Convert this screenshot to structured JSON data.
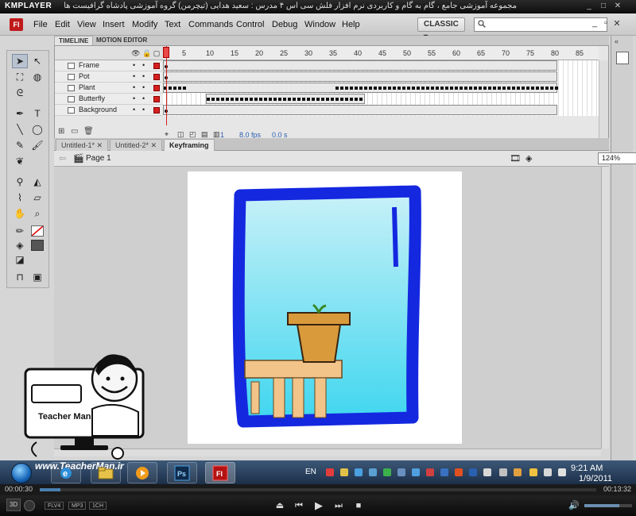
{
  "km_title": {
    "logo": "KMPLAYER",
    "caption": "مجموعه آموزشی جامع ، گام به گام و کاربردی نرم افزار فلش سی اس ۴ مدرس : سعید هدایی (تیچرمن) گروه آموزشی پادشاه گرافیست ها"
  },
  "menubar": {
    "app_logo": "Fl",
    "items": [
      "File",
      "Edit",
      "View",
      "Insert",
      "Modify",
      "Text",
      "Commands",
      "Control",
      "Debug",
      "Window",
      "Help"
    ],
    "workspace": "CLASSIC"
  },
  "timeline": {
    "tabs": [
      "TIMELINE",
      "MOTION EDITOR"
    ],
    "ruler": [
      "1",
      "5",
      "10",
      "15",
      "20",
      "25",
      "30",
      "35",
      "40",
      "45",
      "50",
      "55",
      "60",
      "65",
      "70",
      "75",
      "80",
      "85"
    ],
    "layers": [
      "Frame",
      "Pot",
      "Plant",
      "Butterfly",
      "Background"
    ],
    "status": {
      "frame": "1",
      "fps": "8.0 fps",
      "time": "0.0 s"
    }
  },
  "documents": {
    "tabs": [
      "Untitled-1*",
      "Untitled-2*",
      "Keyframing"
    ],
    "page": "Page 1",
    "zoom": "124%"
  },
  "watermark": {
    "name": "Teacher Man",
    "url": "www.TeacherMan.ir"
  },
  "taskbar": {
    "lang": "EN",
    "time": "9:21 AM",
    "date": "1/9/2011"
  },
  "player": {
    "elapsed": "00:00:30",
    "total": "00:13:32",
    "progress": 0.037,
    "badges": [
      "FLV4",
      "MP3",
      "1CH"
    ]
  }
}
